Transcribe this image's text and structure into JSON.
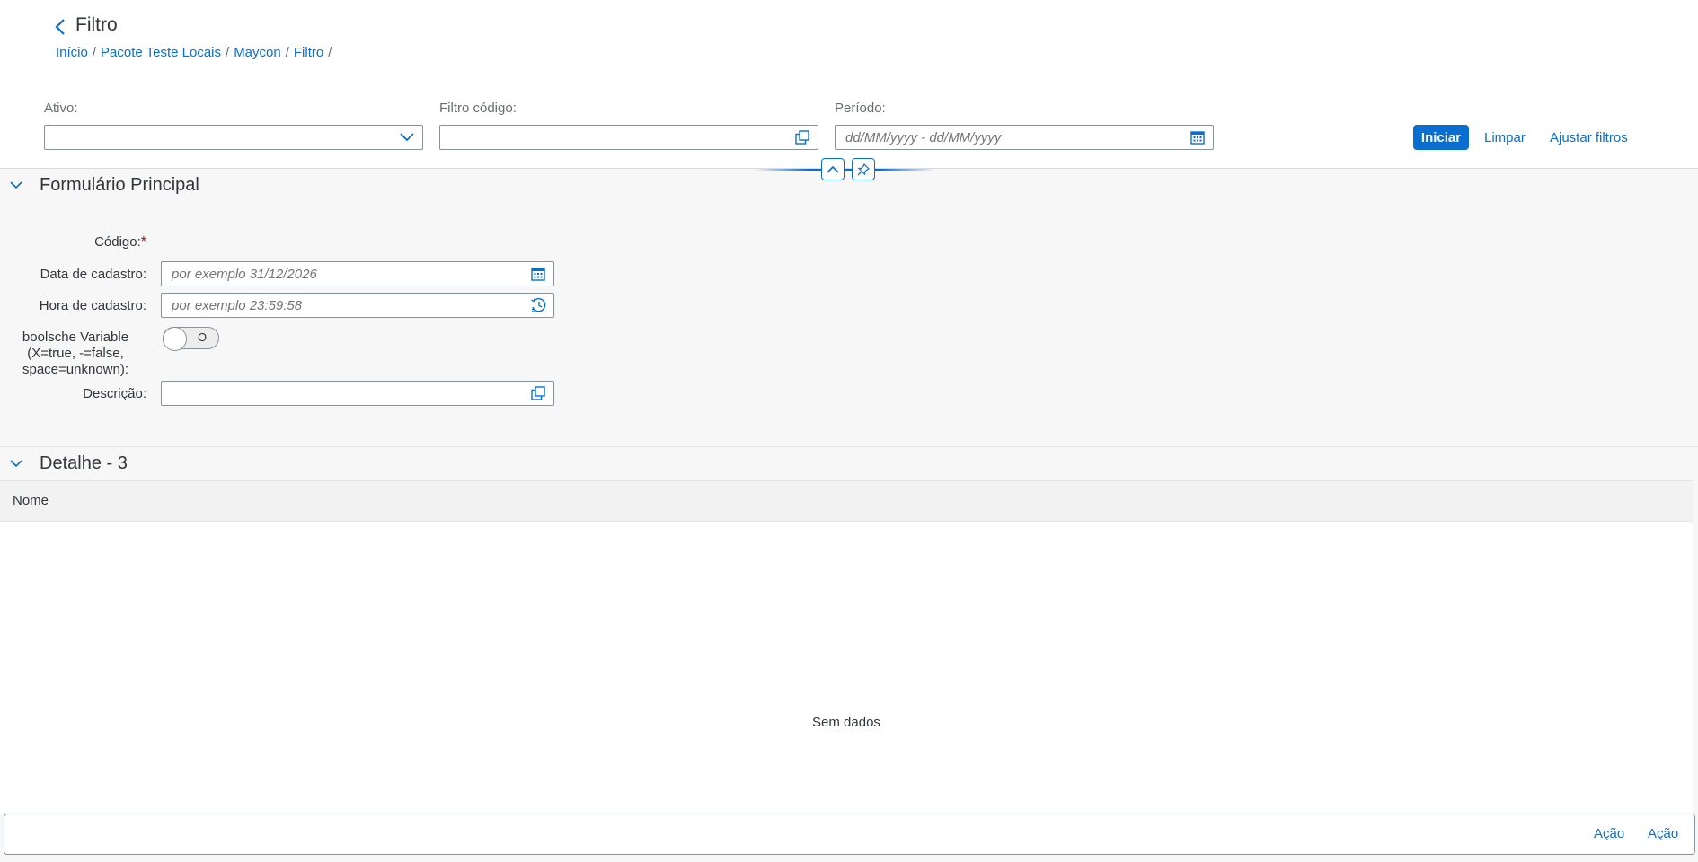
{
  "header": {
    "title": "Filtro",
    "breadcrumbs": [
      "Início",
      "Pacote Teste Locais",
      "Maycon",
      "Filtro"
    ],
    "separator": "/"
  },
  "filterbar": {
    "ativo": {
      "label": "Ativo:",
      "value": ""
    },
    "filtro_codigo": {
      "label": "Filtro código:",
      "value": ""
    },
    "periodo": {
      "label": "Período:",
      "placeholder": "dd/MM/yyyy - dd/MM/yyyy"
    },
    "go_label": "Iniciar",
    "clear_label": "Limpar",
    "adapt_label": "Ajustar filtros"
  },
  "main_form": {
    "title": "Formulário Principal",
    "fields": {
      "codigo": {
        "label": "Código:",
        "required_mark": "*"
      },
      "data_cadastro": {
        "label": "Data de cadastro:",
        "placeholder": "por exemplo 31/12/2026"
      },
      "hora_cadastro": {
        "label": "Hora de cadastro:",
        "placeholder": "por exemplo 23:59:58"
      },
      "boolean_var": {
        "label_lines": [
          "boolsche Variable",
          "(X=true, -=false,",
          "space=unknown):"
        ],
        "switch_text": "O",
        "state": "off"
      },
      "descricao": {
        "label": "Descrição:",
        "value": ""
      }
    }
  },
  "detail": {
    "title": "Detalhe - 3",
    "columns": [
      "Nome"
    ],
    "rows": [],
    "no_data_text": "Sem dados"
  },
  "footer": {
    "actions": [
      "Ação",
      "Ação"
    ]
  },
  "colors": {
    "brand": "#0a6ed1",
    "required": "#bb0000",
    "text": "#32363a"
  },
  "icons": [
    "back-arrow-icon",
    "chevron-down-icon",
    "value-help-icon",
    "calendar-icon",
    "time-icon",
    "collapse-up-icon",
    "pin-icon"
  ]
}
